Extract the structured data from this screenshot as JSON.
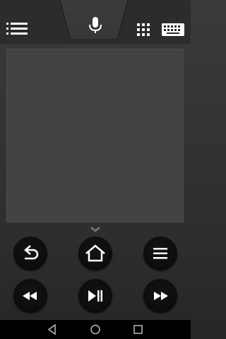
{
  "header": {
    "icons": [
      "list-icon",
      "microphone-icon",
      "apps-grid-icon",
      "keyboard-icon"
    ]
  },
  "touchpad": {
    "present": true
  },
  "controls": {
    "rows": [
      [
        "back-icon",
        "home-icon",
        "menu-icon"
      ],
      [
        "rewind-icon",
        "play-pause-icon",
        "fast-forward-icon"
      ]
    ]
  },
  "system_nav": {
    "icons": [
      "nav-back-icon",
      "nav-home-icon",
      "nav-recents-icon"
    ]
  },
  "colors": {
    "background": "#333333",
    "touchpad": "#434343",
    "button": "#0c0c0c",
    "icon": "#ffffff",
    "navbar": "#000000"
  }
}
